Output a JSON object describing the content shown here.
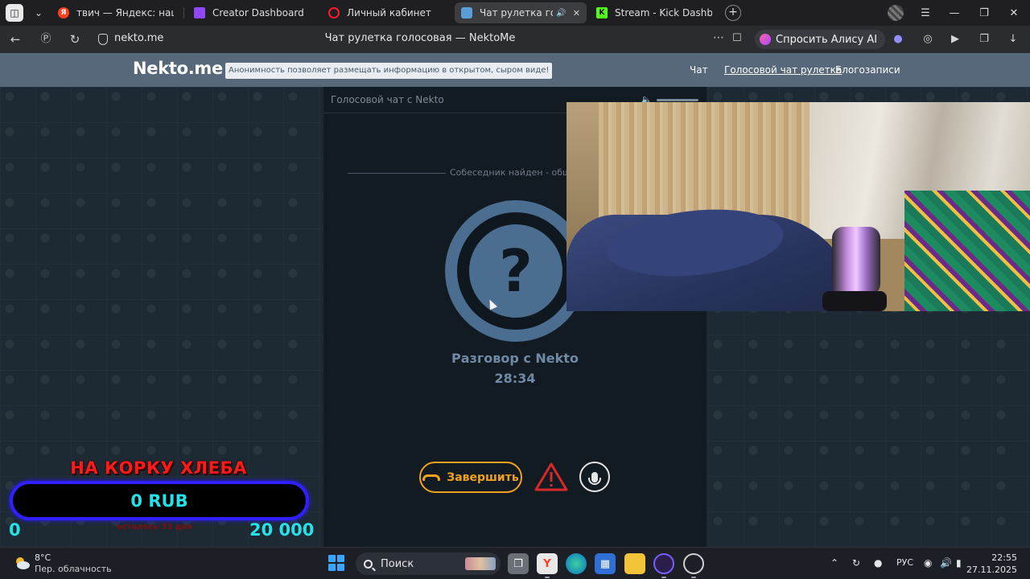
{
  "browser": {
    "tabs": [
      {
        "label": "твич — Яндекс: нашлось",
        "icon": "yandex-icon",
        "color": "#fc3f1d"
      },
      {
        "label": "Creator Dashboard",
        "icon": "twitch-icon",
        "color": "#9146ff"
      },
      {
        "label": "Личный кабинет",
        "icon": "opera-ring-icon",
        "color": "#ff1b2d"
      },
      {
        "label": "Чат рулетка голосов",
        "icon": "nekto-icon",
        "color": "#5aa0d8",
        "active": true
      },
      {
        "label": "Stream - Kick Dashboard",
        "icon": "kick-icon",
        "color": "#53fc18"
      }
    ],
    "url": "nekto.me",
    "page_title": "Чат рулетка голосовая — NektoMe",
    "alice_label": "Спросить Алису AI"
  },
  "site": {
    "logo": "Nekto.me",
    "slogan": "Анонимность позволяет размещать информацию в открытом, сыром виде!",
    "nav": [
      "Чат",
      "Голосовой чат рулетка",
      "Блогозаписи"
    ]
  },
  "chat": {
    "panel_title": "Голосовой чат с Nekto",
    "found_text": "Собеседник найден - общайтесь",
    "avatar_symbol": "?",
    "talk_title": "Разговор с Nekto",
    "talk_time": "28:34",
    "end_label": "Завершить",
    "accent": "#f0a21e"
  },
  "goal": {
    "title": "НА КОРКУ ХЛЕБА",
    "value": "0 RUB",
    "min": "0",
    "max": "20 000",
    "subtitle": "осталось 33 дня"
  },
  "taskbar": {
    "weather_temp": "8°C",
    "weather_desc": "Пер. облачность",
    "search_label": "Поиск",
    "language": "РУС",
    "time": "22:55",
    "date": "27.11.2025"
  }
}
